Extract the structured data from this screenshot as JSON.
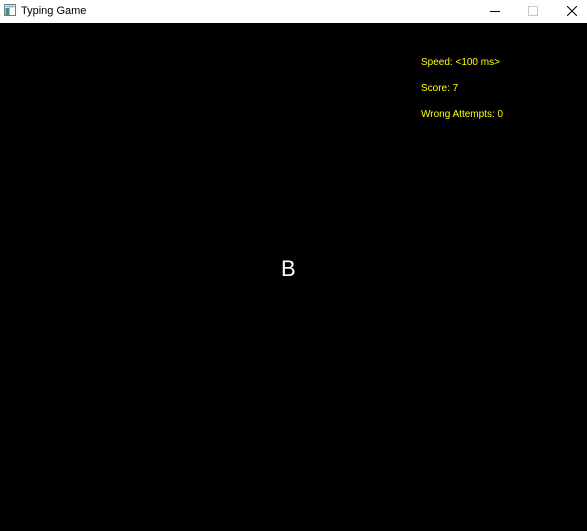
{
  "window": {
    "title": "Typing Game",
    "app_icon": "window-app-icon",
    "controls": {
      "minimize_icon": "minimize-icon",
      "maximize_icon": "maximize-icon",
      "close_icon": "close-icon"
    }
  },
  "hud": {
    "speed": "Speed: <100 ms>",
    "score": "Score: 7",
    "wrong_attempts": "Wrong Attempts: 0"
  },
  "game": {
    "current_letter": "B"
  },
  "colors": {
    "background": "#000000",
    "hud_text": "#ffff00",
    "letter": "#ffffff",
    "titlebar": "#ffffff"
  }
}
